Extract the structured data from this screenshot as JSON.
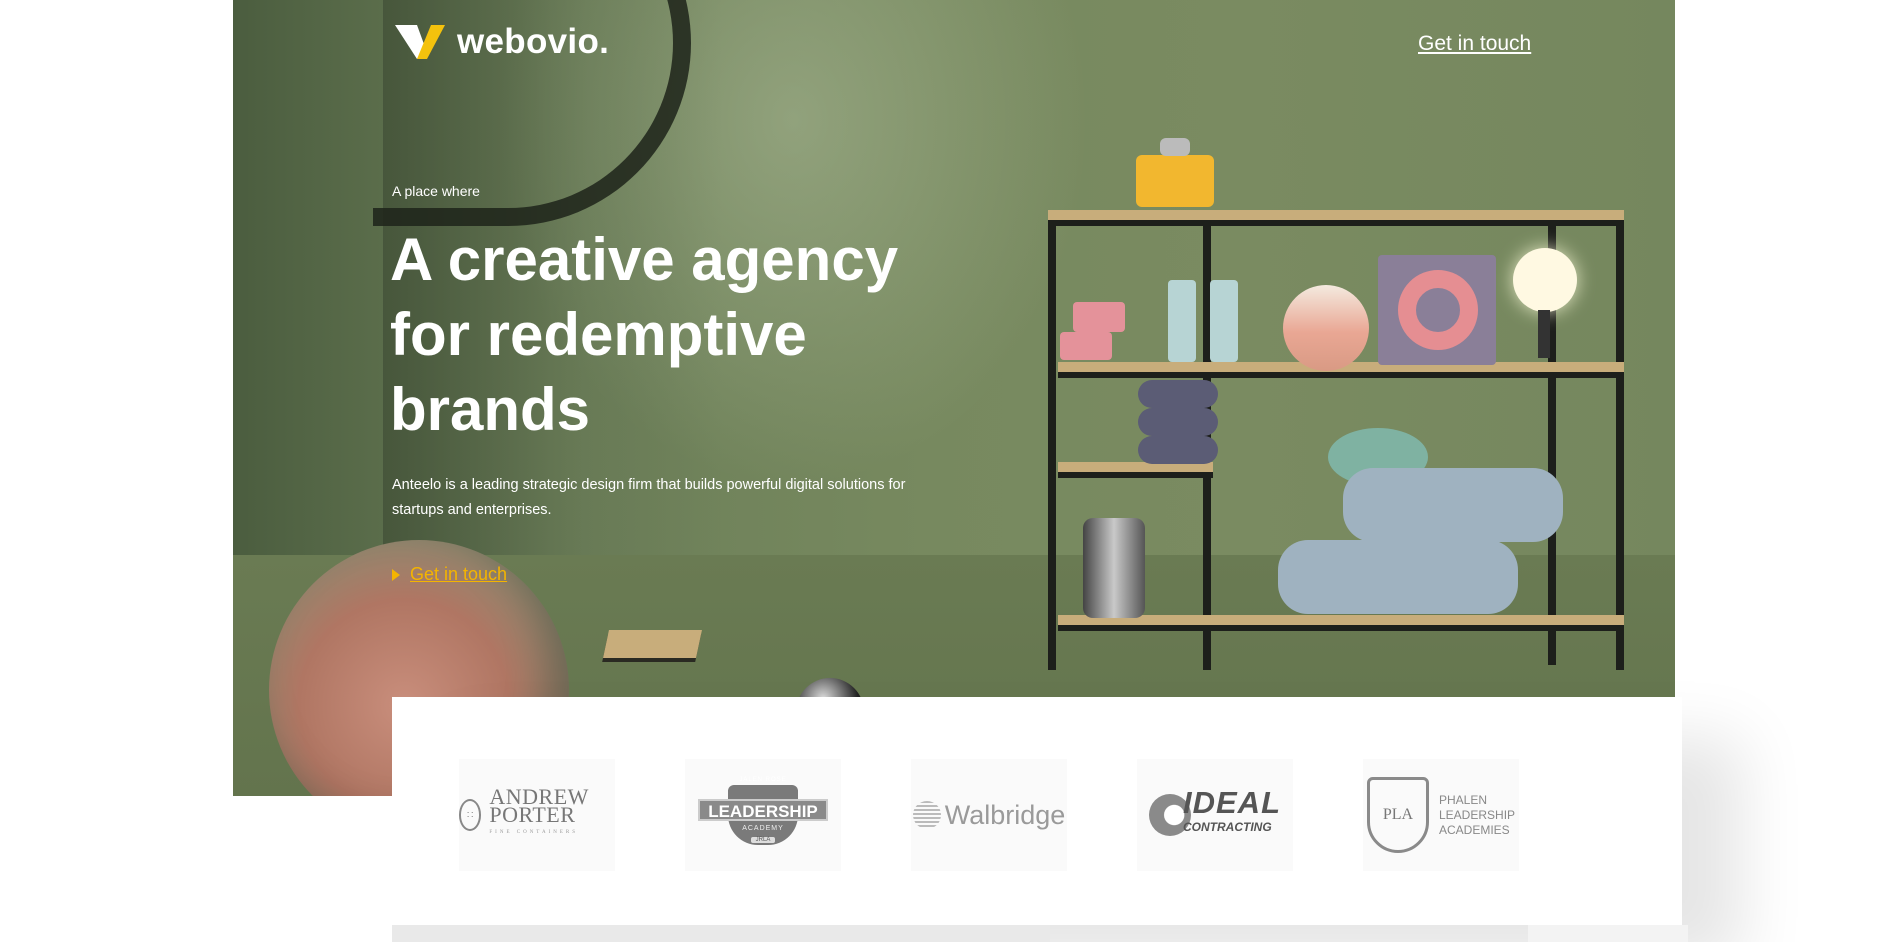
{
  "header": {
    "logo_text": "webovio.",
    "cta_label": "Get in touch"
  },
  "hero": {
    "eyebrow": "A place where",
    "headline": "A creative agency\nfor redemptive\nbrands",
    "description": "Anteelo is a leading strategic design firm that builds powerful digital solutions for startups and enterprises.",
    "cta_label": "Get in touch"
  },
  "clients": [
    {
      "name": "ANDREW PORTER",
      "sub": "FINE CONTAINERS"
    },
    {
      "name": "LEADERSHIP",
      "top": "JALEN ROSE",
      "sub": "ACADEMY",
      "badge": "JRLA"
    },
    {
      "name": "Walbridge"
    },
    {
      "name": "IDEAL",
      "sub": "CONTRACTING"
    },
    {
      "name": "PHALEN LEADERSHIP ACADEMIES",
      "mono": "PLA"
    }
  ],
  "colors": {
    "accent": "#f4b400",
    "hero_green": "#75875e",
    "logo_yellow": "#f4c20d"
  }
}
